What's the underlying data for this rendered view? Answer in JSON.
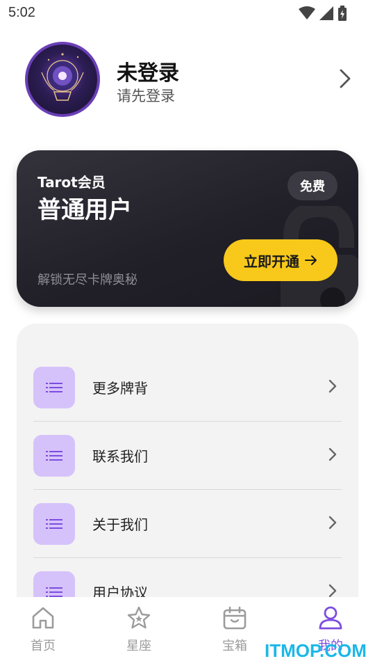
{
  "status_bar": {
    "time": "5:02"
  },
  "profile": {
    "name": "未登录",
    "subtitle": "请先登录"
  },
  "member_card": {
    "label": "Tarot会员",
    "title": "普通用户",
    "badge": "免费",
    "description": "解锁无尽卡牌奥秘",
    "cta": "立即开通"
  },
  "menu": {
    "items": [
      {
        "label": "更多牌背"
      },
      {
        "label": "联系我们"
      },
      {
        "label": "关于我们"
      },
      {
        "label": "用户协议"
      }
    ]
  },
  "bottom_nav": {
    "items": [
      {
        "label": "首页",
        "icon": "home-icon"
      },
      {
        "label": "星座",
        "icon": "star-icon"
      },
      {
        "label": "宝箱",
        "icon": "calendar-box-icon"
      },
      {
        "label": "我的",
        "icon": "user-icon"
      }
    ],
    "active_index": 3
  },
  "watermark": "ITMOP.COM",
  "colors": {
    "accent": "#7c4dde",
    "cta_yellow": "#f8c91b",
    "icon_box": "#d6c2fb",
    "card_dark": "#211f28"
  }
}
